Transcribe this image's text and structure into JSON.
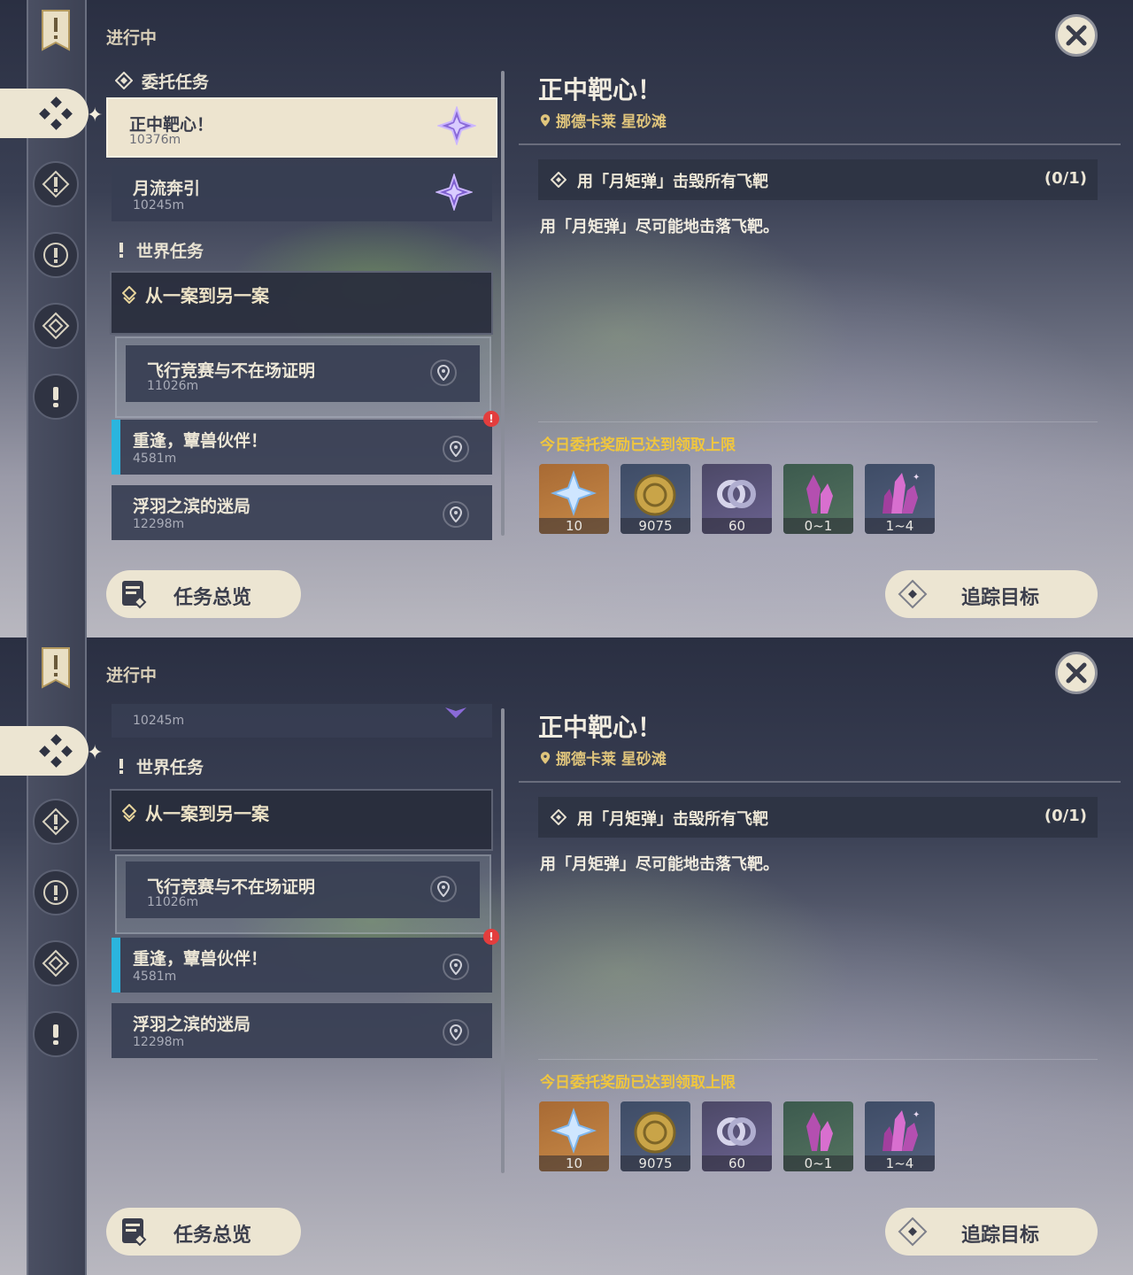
{
  "panels": [
    {
      "section_label": "进行中",
      "list": {
        "commission_category": "委托任务",
        "commissions": [
          {
            "title": "正中靶心！",
            "distance": "10376m",
            "selected": true
          },
          {
            "title": "月流奔引",
            "distance": "10245m",
            "selected": false
          }
        ],
        "world_category": "世界任务",
        "world_group": "从一案到另一案",
        "world_sub": {
          "title": "飞行竞赛与不在场证明",
          "distance": "11026m"
        },
        "world_quests": [
          {
            "title": "重逢，蕈兽伙伴！",
            "distance": "4581m",
            "alert": "!"
          },
          {
            "title": "浮羽之滨的迷局",
            "distance": "12298m"
          }
        ]
      },
      "overview_button": "任务总览",
      "track_button": "追踪目标",
      "detail": {
        "title": "正中靶心！",
        "location": "挪德卡莱 星砂滩",
        "objective": "用「月矩弹」击毁所有飞靶",
        "objective_count": "(0/1)",
        "description": "用「月矩弹」尽可能地击落飞靶。",
        "reward_note": "今日委托奖励已达到领取上限",
        "rewards": [
          {
            "icon": "primogem-icon",
            "count": "10"
          },
          {
            "icon": "mora-icon",
            "count": "9075"
          },
          {
            "icon": "fate-icon",
            "count": "60"
          },
          {
            "icon": "crystal-icon",
            "count": "0~1"
          },
          {
            "icon": "crystal-cluster-icon",
            "count": "1~4"
          }
        ]
      }
    },
    {
      "section_label": "进行中",
      "list": {
        "partial_distance": "10245m",
        "world_category": "世界任务",
        "world_group": "从一案到另一案",
        "world_sub": {
          "title": "飞行竞赛与不在场证明",
          "distance": "11026m"
        },
        "world_quests": [
          {
            "title": "重逢，蕈兽伙伴！",
            "distance": "4581m",
            "alert": "!"
          },
          {
            "title": "浮羽之滨的迷局",
            "distance": "12298m"
          }
        ]
      },
      "overview_button": "任务总览",
      "track_button": "追踪目标",
      "detail": {
        "title": "正中靶心！",
        "location": "挪德卡莱 星砂滩",
        "objective": "用「月矩弹」击毁所有飞靶",
        "objective_count": "(0/1)",
        "description": "用「月矩弹」尽可能地击落飞靶。",
        "reward_note": "今日委托奖励已达到领取上限",
        "rewards": [
          {
            "icon": "primogem-icon",
            "count": "10"
          },
          {
            "icon": "mora-icon",
            "count": "9075"
          },
          {
            "icon": "fate-icon",
            "count": "60"
          },
          {
            "icon": "crystal-icon",
            "count": "0~1"
          },
          {
            "icon": "crystal-cluster-icon",
            "count": "1~4"
          }
        ]
      }
    }
  ]
}
